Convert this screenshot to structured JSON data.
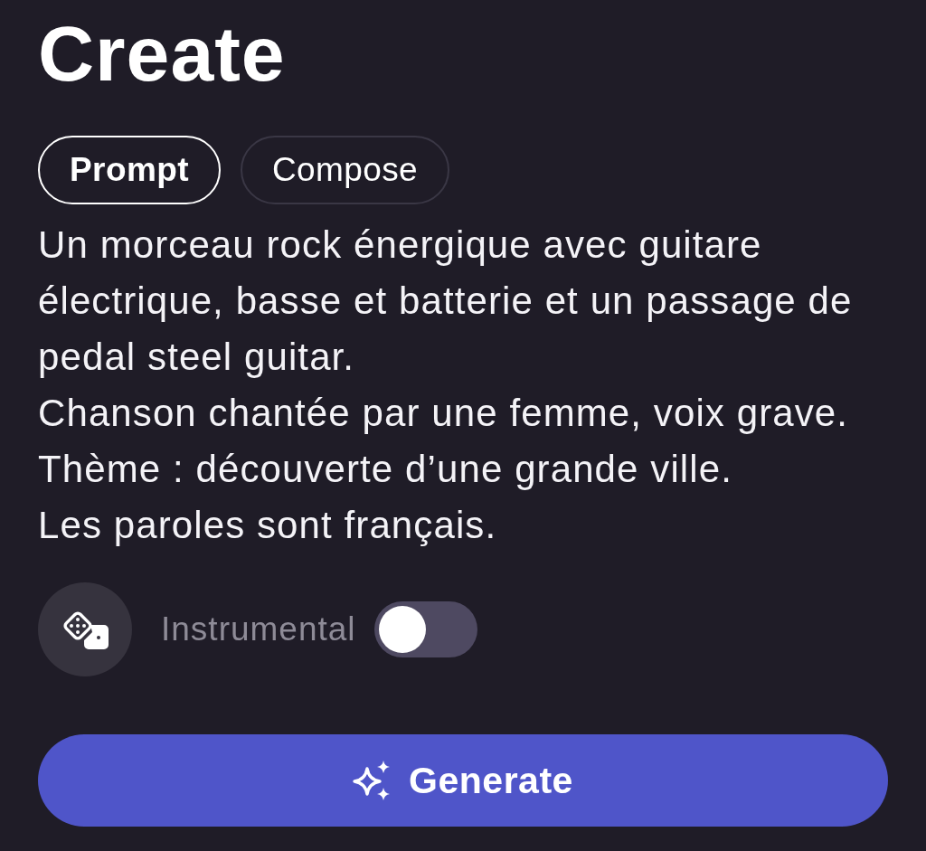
{
  "title": "Create",
  "tabs": [
    {
      "label": "Prompt",
      "selected": true
    },
    {
      "label": "Compose",
      "selected": false
    }
  ],
  "prompt": {
    "value": "Un morceau rock énergique avec guitare\nélectrique, basse et batterie et un passage de\npedal steel guitar.\nChanson chantée par une femme, voix grave.\nThème : découverte d’une grande ville.\nLes paroles sont français."
  },
  "instrumental": {
    "label": "Instrumental",
    "on": false
  },
  "generate_button": {
    "label": "Generate"
  }
}
